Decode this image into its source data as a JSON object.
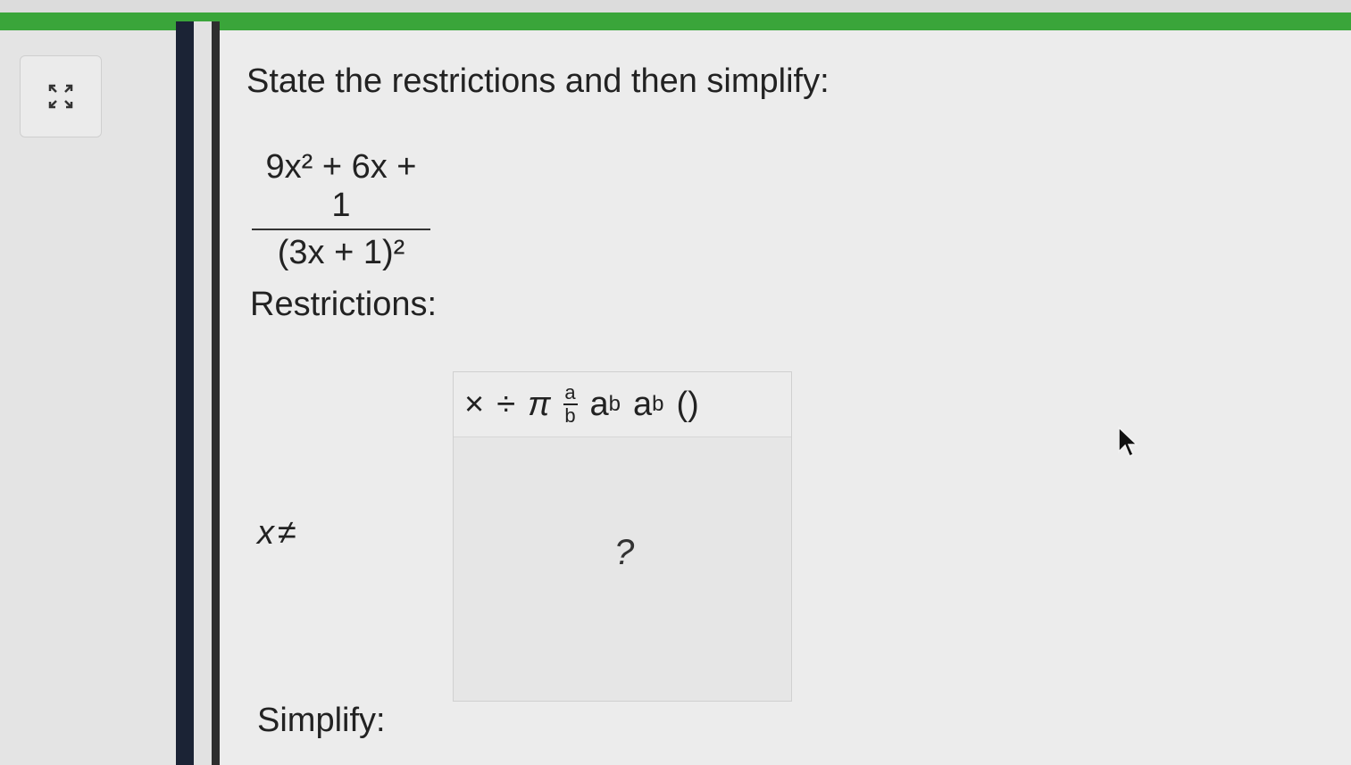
{
  "question": {
    "prompt": "State the restrictions and then simplify:",
    "numerator": "9x² + 6x + 1",
    "denominator": "(3x + 1)²"
  },
  "restrictions": {
    "label": "Restrictions:",
    "variable": "x",
    "neq_symbol": "≠"
  },
  "editor": {
    "toolbar": {
      "times": "×",
      "divide": "÷",
      "pi": "π",
      "frac_num": "a",
      "frac_den": "b",
      "power_base": "a",
      "power_exp": "b",
      "sub_base": "a",
      "sub_index": "b",
      "parens": "()"
    },
    "placeholder": "?"
  },
  "simplify": {
    "label": "Simplify:"
  },
  "colors": {
    "accent_bar": "#3aa53a",
    "divider_dark": "#1b2335"
  }
}
